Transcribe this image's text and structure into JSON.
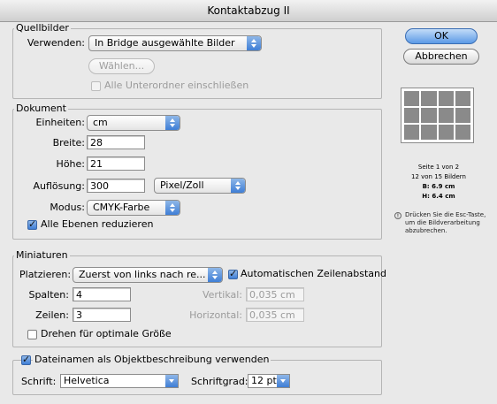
{
  "window": {
    "title": "Kontaktabzug II"
  },
  "buttons": {
    "ok": "OK",
    "cancel": "Abbrechen"
  },
  "quellbilder": {
    "legend": "Quellbilder",
    "use_label": "Verwenden:",
    "use_value": "In Bridge ausgewählte Bilder",
    "choose_button": "Wählen...",
    "subfolders_label": "Alle Unterordner einschließen",
    "subfolders_checked": false
  },
  "dokument": {
    "legend": "Dokument",
    "units_label": "Einheiten:",
    "units_value": "cm",
    "width_label": "Breite:",
    "width_value": "28",
    "height_label": "Höhe:",
    "height_value": "21",
    "resolution_label": "Auflösung:",
    "resolution_value": "300",
    "resolution_unit": "Pixel/Zoll",
    "mode_label": "Modus:",
    "mode_value": "CMYK-Farbe",
    "flatten_label": "Alle Ebenen reduzieren",
    "flatten_checked": true
  },
  "miniaturen": {
    "legend": "Miniaturen",
    "place_label": "Platzieren:",
    "place_value": "Zuerst von links nach re...",
    "auto_spacing_label": "Automatischen Zeilenabstand",
    "auto_spacing_checked": true,
    "columns_label": "Spalten:",
    "columns_value": "4",
    "rows_label": "Zeilen:",
    "rows_value": "3",
    "vertical_label": "Vertikal:",
    "vertical_value": "0,035 cm",
    "horizontal_label": "Horizontal:",
    "horizontal_value": "0,035 cm",
    "rotate_label": "Drehen für optimale Größe",
    "rotate_checked": false
  },
  "caption": {
    "legend": "Dateinamen als Objektbeschreibung verwenden",
    "checked": true,
    "font_label": "Schrift:",
    "font_value": "Helvetica",
    "size_label": "Schriftgrad:",
    "size_value": "12 pt"
  },
  "preview": {
    "grid_columns": 4,
    "grid_rows": 3,
    "page": "Seite 1 von 2",
    "count": "12 von 15 Bildern",
    "w": "B: 6.9 cm",
    "h": "H: 6.4 cm"
  },
  "hint": "Drücken Sie die Esc-Taste, um die Bildverarbeitung abzubrechen.",
  "icons": {
    "info": "info-icon",
    "dropdown": "updown-arrow-icon"
  }
}
